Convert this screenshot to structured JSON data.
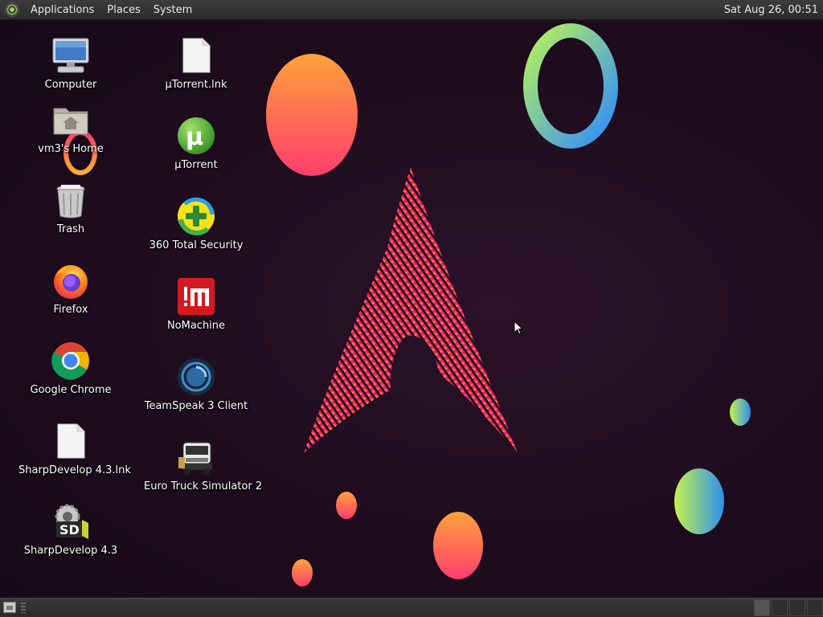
{
  "top_panel": {
    "menus": [
      "Applications",
      "Places",
      "System"
    ],
    "clock": "Sat Aug 26, 00:51"
  },
  "desktop": {
    "icons": [
      {
        "label": "Computer",
        "icon": "computer-icon"
      },
      {
        "label": "vm3's Home",
        "icon": "home-folder-icon"
      },
      {
        "label": "Trash",
        "icon": "trash-icon"
      },
      {
        "label": "Firefox",
        "icon": "firefox-icon"
      },
      {
        "label": "Google Chrome",
        "icon": "chrome-icon"
      },
      {
        "label": "SharpDevelop 4.3.lnk",
        "icon": "file-icon"
      },
      {
        "label": "SharpDevelop 4.3",
        "icon": "sharpdevelop-icon"
      },
      {
        "label": "μTorrent.lnk",
        "icon": "file-icon"
      },
      {
        "label": "μTorrent",
        "icon": "utorrent-icon"
      },
      {
        "label": "360 Total Security",
        "icon": "360-security-icon"
      },
      {
        "label": "NoMachine",
        "icon": "nomachine-icon"
      },
      {
        "label": "TeamSpeak 3 Client",
        "icon": "teamspeak-icon"
      },
      {
        "label": "Euro Truck Simulator 2",
        "icon": "truck-icon"
      }
    ]
  },
  "colors": {
    "background": "#1e0c1e",
    "panel": "#2f2f2f",
    "accent_pink": "#e6186f",
    "accent_orange": "#ff8a2a"
  }
}
